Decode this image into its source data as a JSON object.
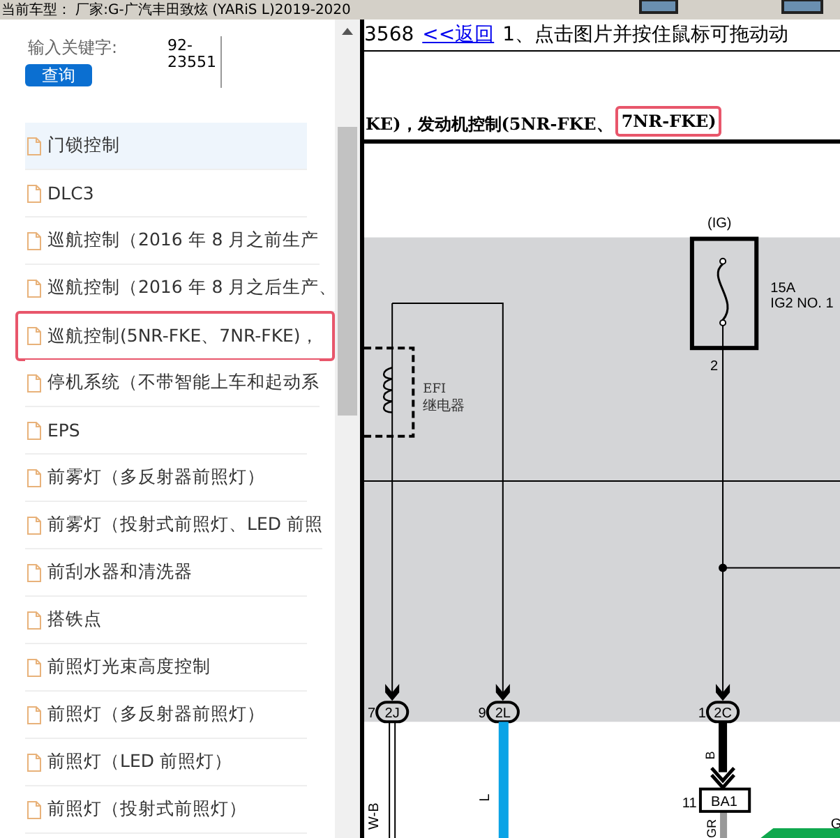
{
  "header": {
    "title": "当前车型： 厂家:G-广汽丰田致炫 (YARiS L)2019-2020"
  },
  "search": {
    "label": "输入关键字:",
    "value": "92-23551",
    "button": "查询"
  },
  "items": [
    {
      "label": "门锁控制",
      "selected": true,
      "highlighted": false
    },
    {
      "label": "DLC3",
      "selected": false,
      "highlighted": false
    },
    {
      "label": "巡航控制（2016 年 8 月之前生产",
      "selected": false,
      "highlighted": false
    },
    {
      "label": "巡航控制（2016 年 8 月之后生产、",
      "selected": false,
      "highlighted": false
    },
    {
      "label": "巡航控制(5NR-FKE、7NR-FKE)，",
      "selected": false,
      "highlighted": true
    },
    {
      "label": "停机系统（不带智能上车和起动系",
      "selected": false,
      "highlighted": false
    },
    {
      "label": "EPS",
      "selected": false,
      "highlighted": false
    },
    {
      "label": "前雾灯（多反射器前照灯）",
      "selected": false,
      "highlighted": false
    },
    {
      "label": "前雾灯（投射式前照灯、LED 前照",
      "selected": false,
      "highlighted": false
    },
    {
      "label": "前刮水器和清洗器",
      "selected": false,
      "highlighted": false
    },
    {
      "label": "搭铁点",
      "selected": false,
      "highlighted": false
    },
    {
      "label": "前照灯光束高度控制",
      "selected": false,
      "highlighted": false
    },
    {
      "label": "前照灯（多反射器前照灯）",
      "selected": false,
      "highlighted": false
    },
    {
      "label": "前照灯（LED 前照灯）",
      "selected": false,
      "highlighted": false
    },
    {
      "label": "前照灯（投射式前照灯）",
      "selected": false,
      "highlighted": false
    }
  ],
  "content": {
    "page": "3568",
    "back_link": "<<返回",
    "instruction": "1、点击图片并按住鼠标可拖动动",
    "caption": "KE)，发动机控制(5NR-FKE、",
    "caption_highlight": "7NR-FKE)"
  },
  "diagram": {
    "ig": "(IG)",
    "fuse_rating": "15A",
    "fuse_name": "IG2 NO. 1",
    "fuse_pin": "2",
    "relay_name": "EFI",
    "relay_label": "继电器",
    "connectors": [
      {
        "pin": "7",
        "code": "2J",
        "wire": "W-B"
      },
      {
        "pin": "9",
        "code": "2L",
        "wire": "L"
      },
      {
        "pin": "1",
        "code": "2C",
        "wire": "B"
      }
    ],
    "junction_pin": "11",
    "junction_code": "BA1",
    "lower_wire": "GR",
    "side_wire": "G"
  }
}
